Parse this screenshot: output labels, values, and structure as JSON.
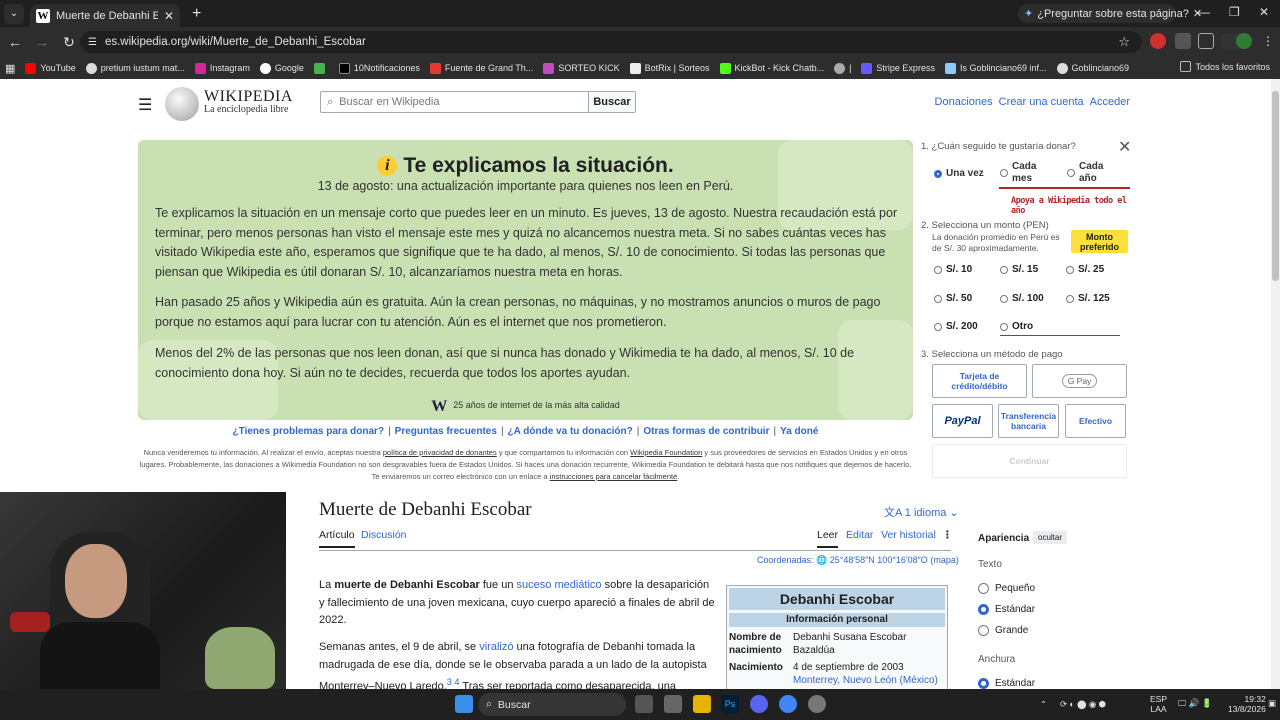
{
  "browser": {
    "tab_title": "Muerte de Debanhi Escobar - W",
    "tab_favicon": "W",
    "ask_button": "¿Preguntar sobre esta página?",
    "url": "es.wikipedia.org/wiki/Muerte_de_Debanhi_Escobar",
    "bookmarks": [
      "YouTube",
      "pretium iustum mat...",
      "Instagram",
      "Google",
      "",
      "10Notificaciones",
      "Fuente de Grand Th...",
      "SORTEO KICK",
      "BotRix | Sorteos",
      "KickBot - Kick Chatb...",
      "|",
      "Stripe Express",
      "Is Goblinciano69 inf...",
      "Goblinciano69"
    ],
    "bookmarks_right": "Todos los favoritos"
  },
  "wiki_header": {
    "logo_title": "WIKIPEDIA",
    "logo_tagline": "La enciclopedia libre",
    "search_placeholder": "Buscar en Wikipedia",
    "search_button": "Buscar",
    "links": [
      "Donaciones",
      "Crear una cuenta",
      "Acceder"
    ]
  },
  "banner": {
    "title": "Te explicamos la situación.",
    "subtitle": "13 de agosto: una actualización importante para quienes nos leen en Perú.",
    "p1": "Te explicamos la situación en un mensaje corto que puedes leer en un minuto. Es jueves, 13 de agosto. Nuestra recaudación está por terminar, pero menos personas han visto el mensaje este mes y quizá no alcancemos nuestra meta. Si no sabes cuántas veces has visitado Wikipedia este año, esperamos que signifique que te ha dado, al menos, S/. 10 de conocimiento. Si todas las personas que piensan que Wikipedia es útil donaran S/. 10, alcanzaríamos nuestra meta en horas.",
    "p2": "Han pasado 25 años y Wikipedia aún es gratuita. Aún la crean personas, no máquinas, y no mostramos anuncios o muros de pago porque no estamos aquí para lucrar con tu atención. Aún es el internet que nos prometieron.",
    "p3": "Menos del 2% de las personas que nos leen donan, así que si nunca has donado y Wikimedia te ha dado, al menos, S/. 10 de conocimiento dona hoy. Si aún no te decides, recuerda que todos los aportes ayudan.",
    "footer": "25 años de internet de la más alta calidad",
    "links": [
      "¿Tienes problemas para donar?",
      "Preguntas frecuentes",
      "¿A dónde va tu donación?",
      "Otras formas de contribuir",
      "Ya doné"
    ],
    "legal_1": "Nunca venderemos tu información. Al realizar el envío, aceptas nuestra",
    "legal_link1": "política de privacidad de donantes",
    "legal_2": "y que compartamos tu información con",
    "legal_link2": "Wikipedia Foundation",
    "legal_3": "y sus proveedores de servicios en Estados Unidos y en otros lugares. Probablemente, las donaciones a Wikimedia Foundation no son desgravables fuera de Estados Unidos. Si haces una donación recurrente, Wikimedia Foundation te debitará hasta que nos notifiques que dejemos de hacerlo. Te enviaremos un correo electrónico con un enlace a",
    "legal_link3": "instrucciones para cancelar fácilmente",
    "legal_4": "."
  },
  "donate": {
    "step1": "1. ¿Cuán seguido te gustaría donar?",
    "freq": [
      "Una vez",
      "Cada mes",
      "Cada año"
    ],
    "apoya": "Apoya a Wikipedia todo el año",
    "step2": "2. Selecciona un monto (PEN)",
    "avg": "La donación promedio en Perú es de S/. 30 aproximadamente.",
    "preferred": "Monto preferido",
    "amounts": [
      "S/. 10",
      "S/. 15",
      "S/. 25",
      "S/. 50",
      "S/. 100",
      "S/. 125",
      "S/. 200",
      "Otro"
    ],
    "step3": "3. Selecciona un método de pago",
    "methods": [
      "Tarjeta de crédito/débito",
      "G Pay",
      "PayPal",
      "Transferencia bancaria",
      "Efectivo"
    ],
    "continue": "Continuar"
  },
  "article": {
    "title": "Muerte de Debanhi Escobar",
    "lang": "1 idioma",
    "tabs": [
      "Artículo",
      "Discusión",
      "Leer",
      "Editar",
      "Ver historial"
    ],
    "coords_label": "Coordenadas:",
    "coords_value": "25°48′58″N 100°16′08″O",
    "coords_map": "(mapa)",
    "p1_a": "La",
    "p1_b": "muerte de Debanhi Escobar",
    "p1_c": "fue un",
    "p1_link": "suceso mediático",
    "p1_d": "sobre la desaparición y fallecimiento de una joven mexicana, cuyo cuerpo apareció a finales de abril de 2022.",
    "p2_a": "Semanas antes, el 9 de abril, se",
    "p2_link": "viralizó",
    "p2_b": "una fotografía de Debanhi tomada la madrugada de ese día, donde se le observaba parada a un lado de la autopista Monterrey–Nuevo Laredo.",
    "p2_ref": "3 4",
    "p2_c": "Tras ser reportada como desaparecida, una",
    "infobox": {
      "title": "Debanhi Escobar",
      "section": "Información personal",
      "name_label": "Nombre de nacimiento",
      "name_value": "Debanhi Susana Escobar Bazaldúa",
      "birth_label": "Nacimiento",
      "birth_date": "4 de septiembre de 2003",
      "birth_place": "Monterrey, Nuevo León (México)"
    }
  },
  "appearance": {
    "title": "Apariencia",
    "hide": "ocultar",
    "text_label": "Texto",
    "sizes": [
      "Pequeño",
      "Estándar",
      "Grande"
    ],
    "width_label": "Anchura",
    "width_opt": "Estándar"
  },
  "taskbar": {
    "search": "Buscar",
    "lang": "ESP",
    "lang2": "LAA",
    "time": "19:32",
    "date": "13/8/2026"
  }
}
